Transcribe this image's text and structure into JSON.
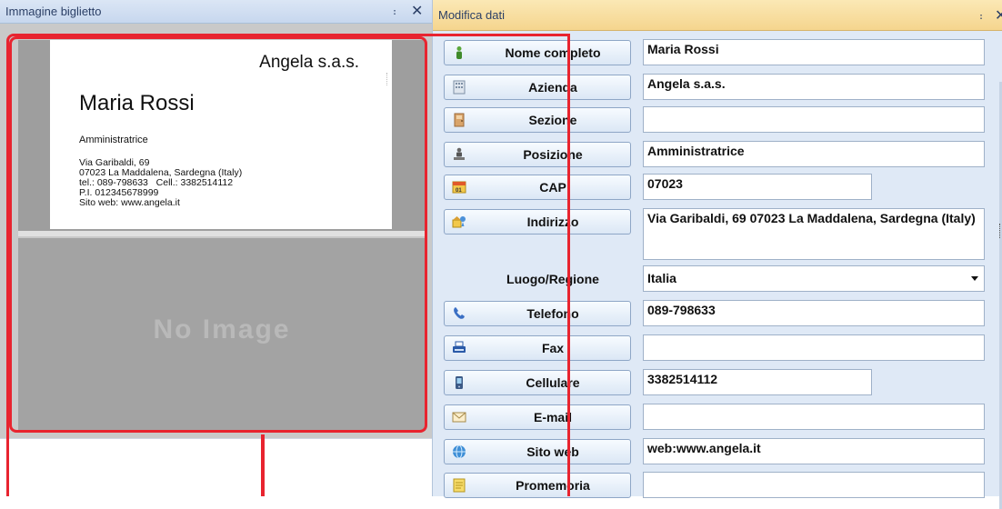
{
  "left_panel": {
    "title": "Immagine biglietto",
    "pin_glyph": "։",
    "close_glyph": "✕",
    "card": {
      "company": "Angela s.a.s.",
      "name": "Maria Rossi",
      "role": "Amministratrice",
      "address_lines": "Via Garibaldi, 69\n07023 La Maddalena, Sardegna (Italy)\ntel.: 089-798633   Cell.: 3382514112\nP.I. 012345678999\nSito web: www.angela.it"
    },
    "no_image_text": "No Image"
  },
  "right_panel": {
    "title": "Modifica dati",
    "pin_glyph": "։",
    "close_glyph": "✕",
    "fields": {
      "nome_completo": {
        "label": "Nome completo",
        "value": "Maria Rossi"
      },
      "azienda": {
        "label": "Azienda",
        "value": "Angela s.a.s."
      },
      "sezione": {
        "label": "Sezione",
        "value": ""
      },
      "posizione": {
        "label": "Posizione",
        "value": "Amministratrice"
      },
      "cap": {
        "label": "CAP",
        "value": "07023"
      },
      "indirizzo": {
        "label": "Indirizzo",
        "value": "Via Garibaldi, 69 07023 La Maddalena, Sardegna (Italy)"
      },
      "luogo_regione": {
        "label": "Luogo/Regione",
        "value": "Italia"
      },
      "telefono": {
        "label": "Telefono",
        "value": "089-798633"
      },
      "fax": {
        "label": "Fax",
        "value": ""
      },
      "cellulare": {
        "label": "Cellulare",
        "value": "3382514112"
      },
      "email": {
        "label": "E-mail",
        "value": ""
      },
      "sito_web": {
        "label": "Sito web",
        "value": "web:www.angela.it"
      },
      "promemoria": {
        "label": "Promemoria",
        "value": ""
      }
    }
  },
  "colors": {
    "highlight_red": "#e8242f",
    "left_titlebar": "#c7d7ee",
    "right_titlebar": "#f5d58e",
    "panel_background": "#dfe9f6"
  },
  "icons": [
    "person-icon",
    "building-icon",
    "door-icon",
    "desk-person-icon",
    "postal-code-icon",
    "address-icon",
    "phone-icon",
    "fax-icon",
    "mobile-phone-icon",
    "envelope-icon",
    "globe-icon",
    "memo-icon",
    "pin-icon",
    "close-icon",
    "dropdown-caret-icon"
  ]
}
